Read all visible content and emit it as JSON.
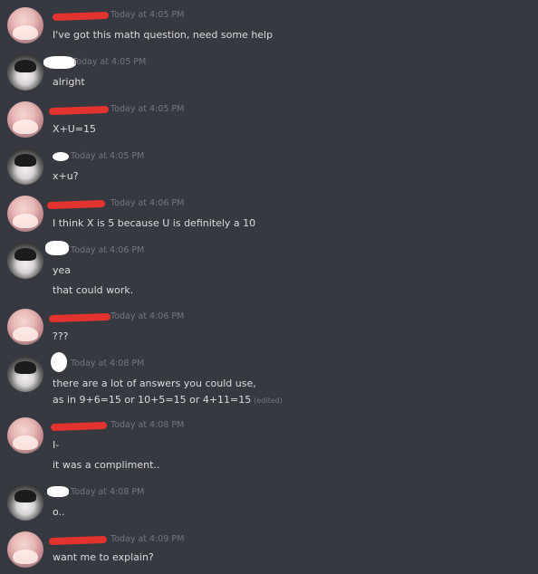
{
  "messages": [
    {
      "avatar": "pink-anime-avatar",
      "timestamp": "Today at 4:05 PM",
      "lines": [
        "I've got this math question, need some help"
      ]
    },
    {
      "avatar": "dark-anime-avatar",
      "timestamp": "Today at 4:05 PM",
      "lines": [
        "alright"
      ]
    },
    {
      "avatar": "pink-anime-avatar",
      "timestamp": "Today at 4:05 PM",
      "lines": [
        "X+U=15"
      ]
    },
    {
      "avatar": "dark-anime-avatar",
      "timestamp": "Today at 4:05 PM",
      "lines": [
        "x+u?"
      ]
    },
    {
      "avatar": "pink-anime-avatar",
      "timestamp": "Today at 4:06 PM",
      "lines": [
        "I think X is 5 because U is definitely a 10"
      ]
    },
    {
      "avatar": "dark-anime-avatar",
      "timestamp": "Today at 4:06 PM",
      "lines": [
        "yea",
        "that could work."
      ]
    },
    {
      "avatar": "pink-anime-avatar",
      "timestamp": "Today at 4:06 PM",
      "lines": [
        "???"
      ]
    },
    {
      "avatar": "dark-anime-avatar",
      "timestamp": "Today at 4:08 PM",
      "lines": [
        "there are a lot of answers you could use,",
        "as in 9+6=15 or 10+5=15 or 4+11=15"
      ],
      "edited": "(edited)"
    },
    {
      "avatar": "pink-anime-avatar",
      "timestamp": "Today at 4:08 PM",
      "lines": [
        "I-",
        "it was a compliment.."
      ]
    },
    {
      "avatar": "dark-anime-avatar",
      "timestamp": "Today at 4:08 PM",
      "lines": [
        "o.."
      ]
    },
    {
      "avatar": "pink-anime-avatar",
      "timestamp": "Today at 4:09 PM",
      "lines": [
        "want me to explain?"
      ]
    }
  ]
}
